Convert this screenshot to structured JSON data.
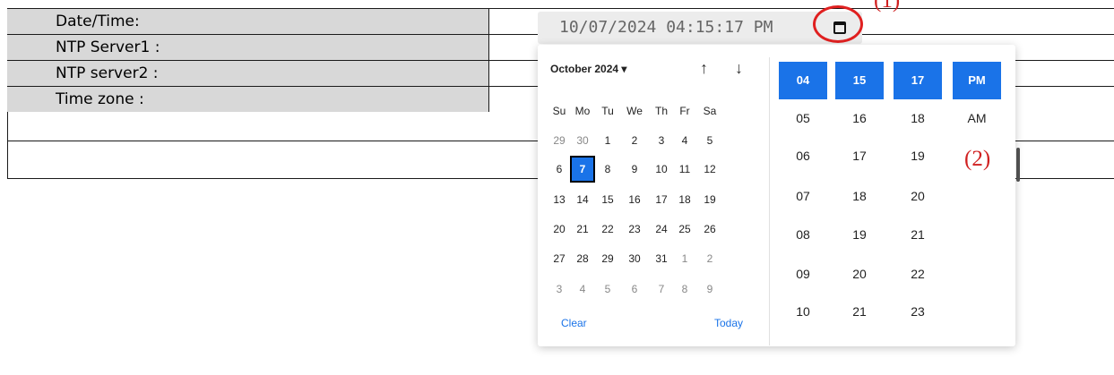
{
  "form": {
    "rows": [
      {
        "label": "Date/Time:"
      },
      {
        "label": "NTP Server1 :"
      },
      {
        "label": "NTP server2 :"
      },
      {
        "label": "Time zone :"
      }
    ],
    "datetime_value": "10/07/2024 04:15:17 PM"
  },
  "annotations": {
    "one": "(1)",
    "two": "(2)"
  },
  "icons": {
    "calendar": "calendar-icon"
  },
  "colors": {
    "accent": "#1a73e8",
    "annotation": "#e02020"
  },
  "picker": {
    "month_label": "October 2024",
    "dropdown_glyph": "▾",
    "nav_up": "↑",
    "nav_down": "↓",
    "weekdays": [
      "Su",
      "Mo",
      "Tu",
      "We",
      "Th",
      "Fr",
      "Sa"
    ],
    "weeks": [
      [
        "29",
        "30",
        "1",
        "2",
        "3",
        "4",
        "5"
      ],
      [
        "6",
        "7",
        "8",
        "9",
        "10",
        "11",
        "12"
      ],
      [
        "13",
        "14",
        "15",
        "16",
        "17",
        "18",
        "19"
      ],
      [
        "20",
        "21",
        "22",
        "23",
        "24",
        "25",
        "26"
      ],
      [
        "27",
        "28",
        "29",
        "30",
        "31",
        "1",
        "2"
      ],
      [
        "3",
        "4",
        "5",
        "6",
        "7",
        "8",
        "9"
      ]
    ],
    "selected_day": "7",
    "clear_label": "Clear",
    "today_label": "Today",
    "time_columns": [
      {
        "selected": "04",
        "options": [
          "05",
          "06",
          "07",
          "08",
          "09",
          "10"
        ]
      },
      {
        "selected": "15",
        "options": [
          "16",
          "17",
          "18",
          "19",
          "20",
          "21"
        ]
      },
      {
        "selected": "17",
        "options": [
          "18",
          "19",
          "20",
          "21",
          "22",
          "23"
        ]
      },
      {
        "selected": "PM",
        "options": [
          "AM"
        ]
      }
    ]
  }
}
